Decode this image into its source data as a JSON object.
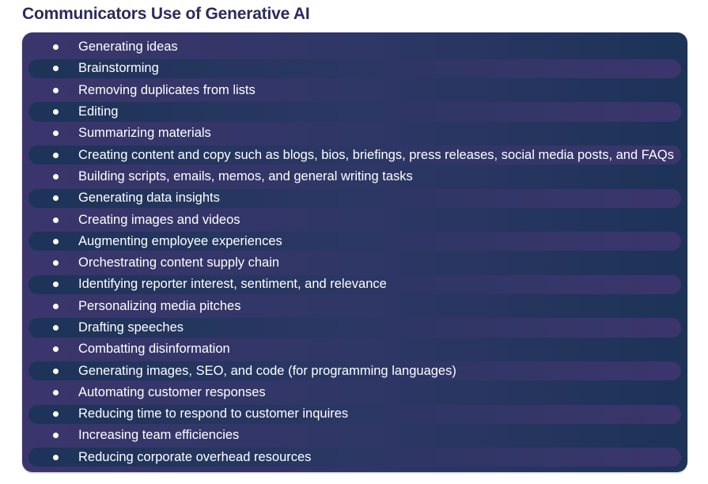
{
  "title": "Communicators Use of Generative AI",
  "colors": {
    "title": "#2b2b5e",
    "panel_left": "#3b356c",
    "panel_right": "#1d3358",
    "text": "#ffffff"
  },
  "items": [
    {
      "label": "Generating ideas"
    },
    {
      "label": "Brainstorming"
    },
    {
      "label": "Removing duplicates from lists"
    },
    {
      "label": "Editing"
    },
    {
      "label": "Summarizing materials"
    },
    {
      "label": "Creating content and copy such as blogs, bios, briefings, press releases, social media posts, and FAQs"
    },
    {
      "label": "Building scripts, emails, memos, and general writing tasks"
    },
    {
      "label": "Generating data insights"
    },
    {
      "label": "Creating images and videos"
    },
    {
      "label": "Augmenting employee experiences"
    },
    {
      "label": "Orchestrating content supply chain"
    },
    {
      "label": "Identifying reporter interest, sentiment, and relevance"
    },
    {
      "label": "Personalizing media pitches"
    },
    {
      "label": "Drafting speeches"
    },
    {
      "label": "Combatting disinformation"
    },
    {
      "label": "Generating images, SEO, and code (for programming languages)"
    },
    {
      "label": "Automating customer responses"
    },
    {
      "label": "Reducing time to respond to customer inquires"
    },
    {
      "label": "Increasing team efficiencies"
    },
    {
      "label": "Reducing corporate overhead resources"
    }
  ]
}
